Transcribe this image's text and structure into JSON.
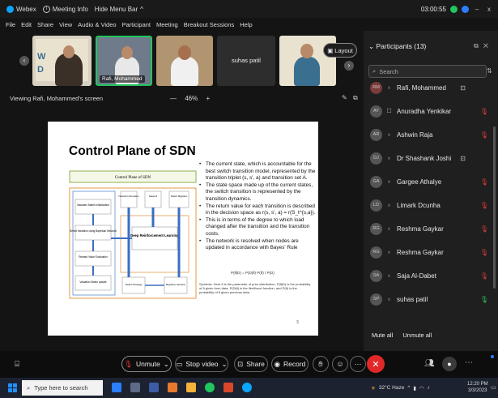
{
  "titlebar": {
    "app": "Webex",
    "meeting_info": "Meeting Info",
    "hide_menu": "Hide Menu Bar",
    "hide_menu_caret": "^",
    "timer": "03:00:55",
    "minimize": "–",
    "close": "x"
  },
  "menu": [
    "File",
    "Edit",
    "Share",
    "View",
    "Audio & Video",
    "Participant",
    "Meeting",
    "Breakout Sessions",
    "Help"
  ],
  "thumbnails": [
    {
      "name": "",
      "slide_text_1": "W",
      "slide_text_2": "D"
    },
    {
      "name": "Rafi, Mohammed"
    },
    {
      "name": ""
    },
    {
      "name": "suhas patil"
    },
    {
      "name": ""
    }
  ],
  "layout_label": "Layout",
  "viewing_label": "Viewing Rafi, Mohammed's screen",
  "zoom": {
    "minus": "—",
    "value": "46%",
    "plus": "+"
  },
  "slide": {
    "title": "Control Plane of SDN",
    "diagram": {
      "header": "Control Plane of SDN",
      "boxes": [
        "Valuation Matrix Initialization",
        "Select transition using Bayesian Network",
        "Reward Value Evaluation",
        "Valuation Matrix update",
        "Deep Reinforcement Learning",
        "Switch Strategy",
        "Migration decision"
      ],
      "top_labels": [
        "Network Information",
        "Network",
        "Switch Migration"
      ]
    },
    "bullets": [
      "The current state, which is accountable for the best switch transition model, represented by the transition triplet (s, s', a) and transition set A.",
      "The state space made up of the current states, the switch transition is represented by the transition dynamics.",
      "The return value for each transition is described in the decision space as r(s, s', a) = r(S_t^{s,a}).",
      "This is in terms of the degree to which load changed after the transition and the transition costs.",
      "The network is resolved when nodes are updated in accordance with Bayes' Rule"
    ],
    "formula": "P(θ|D) = P(D|θ) P(θ) / P(D)",
    "footnote": "Here θ is the parameter of prior distribution, P(θ|D) is the probability of θ given from data, P(D|θ) is the likelihood function, and P(θ) is the probability of θ given previous data.",
    "footnote_prefix": "Symbols:",
    "page": "3"
  },
  "participants": {
    "header": "Participants (13)",
    "search_placeholder": "Search",
    "list": [
      {
        "initials": "RM",
        "name": "Rafi, Mohammed",
        "status": "sharing",
        "mic": "muted-red"
      },
      {
        "initials": "AY",
        "name": "Anuradha Yenkikar",
        "status": "muted",
        "mic": "phone"
      },
      {
        "initials": "AR",
        "name": "Ashwin Raja",
        "status": "muted",
        "mic": "muted"
      },
      {
        "initials": "DJ",
        "name": "Dr Shashank Joshi",
        "status": "sharing",
        "mic": "muted"
      },
      {
        "initials": "GA",
        "name": "Gargee Athalye",
        "status": "muted",
        "mic": "muted"
      },
      {
        "initials": "LD",
        "name": "Limark Dcunha",
        "status": "muted",
        "mic": "muted"
      },
      {
        "initials": "RG",
        "name": "Reshma Gaykar",
        "status": "muted",
        "mic": "muted"
      },
      {
        "initials": "RG",
        "name": "Reshma Gaykar",
        "status": "muted",
        "mic": "muted"
      },
      {
        "initials": "SA",
        "name": "Saja Al-Dabet",
        "status": "muted",
        "mic": "muted"
      },
      {
        "initials": "SP",
        "name": "suhas patil",
        "status": "on",
        "mic": "muted"
      }
    ],
    "mute_all": "Mute all",
    "unmute_all": "Unmute all"
  },
  "controls": {
    "unmute": "Unmute",
    "stop_video": "Stop video",
    "share": "Share",
    "record": "Record"
  },
  "taskbar": {
    "search_placeholder": "Type here to search",
    "weather": "32°C Haze",
    "time": "12:20 PM",
    "date": "3/3/2023"
  },
  "colors": {
    "leave": "#e02828",
    "muted": "#e03a3a",
    "unmuted": "#2dc653",
    "accent": "#0aa5ff"
  }
}
